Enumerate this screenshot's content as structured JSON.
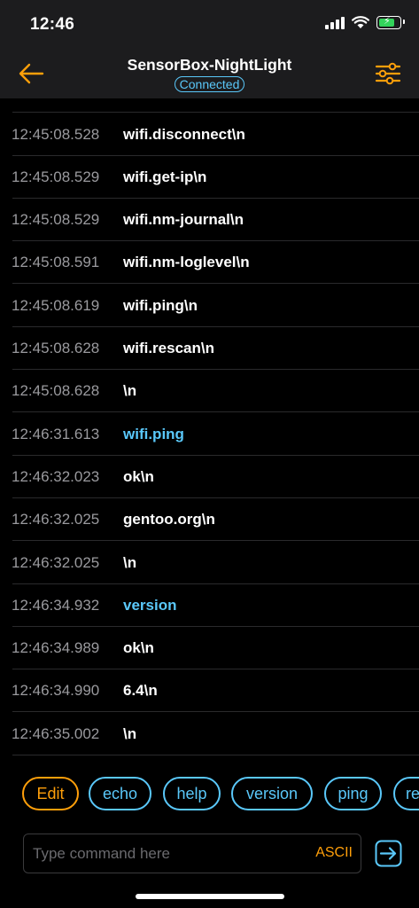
{
  "status_bar": {
    "time": "12:46"
  },
  "header": {
    "title": "SensorBox-NightLight",
    "status": "Connected"
  },
  "log": [
    {
      "time": "12:45:08.528",
      "text": "wifi.disconnect\\n",
      "direction": "received"
    },
    {
      "time": "12:45:08.529",
      "text": "wifi.get-ip\\n",
      "direction": "received"
    },
    {
      "time": "12:45:08.529",
      "text": "wifi.nm-journal\\n",
      "direction": "received"
    },
    {
      "time": "12:45:08.591",
      "text": "wifi.nm-loglevel\\n",
      "direction": "received"
    },
    {
      "time": "12:45:08.619",
      "text": "wifi.ping\\n",
      "direction": "received"
    },
    {
      "time": "12:45:08.628",
      "text": "wifi.rescan\\n",
      "direction": "received"
    },
    {
      "time": "12:45:08.628",
      "text": "\\n",
      "direction": "received"
    },
    {
      "time": "12:46:31.613",
      "text": "wifi.ping",
      "direction": "sent"
    },
    {
      "time": "12:46:32.023",
      "text": "ok\\n",
      "direction": "received"
    },
    {
      "time": "12:46:32.025",
      "text": "gentoo.org\\n",
      "direction": "received"
    },
    {
      "time": "12:46:32.025",
      "text": "\\n",
      "direction": "received"
    },
    {
      "time": "12:46:34.932",
      "text": "version",
      "direction": "sent"
    },
    {
      "time": "12:46:34.989",
      "text": "ok\\n",
      "direction": "received"
    },
    {
      "time": "12:46:34.990",
      "text": "6.4\\n",
      "direction": "received"
    },
    {
      "time": "12:46:35.002",
      "text": "\\n",
      "direction": "received"
    }
  ],
  "chips": [
    "Edit",
    "echo",
    "help",
    "version",
    "ping",
    "re"
  ],
  "input": {
    "placeholder": "Type command here",
    "value": "",
    "mode": "ASCII"
  },
  "colors": {
    "accent": "#ff9f0a",
    "link": "#5ac8fa",
    "background": "#000000",
    "bar": "#1c1c1e"
  }
}
